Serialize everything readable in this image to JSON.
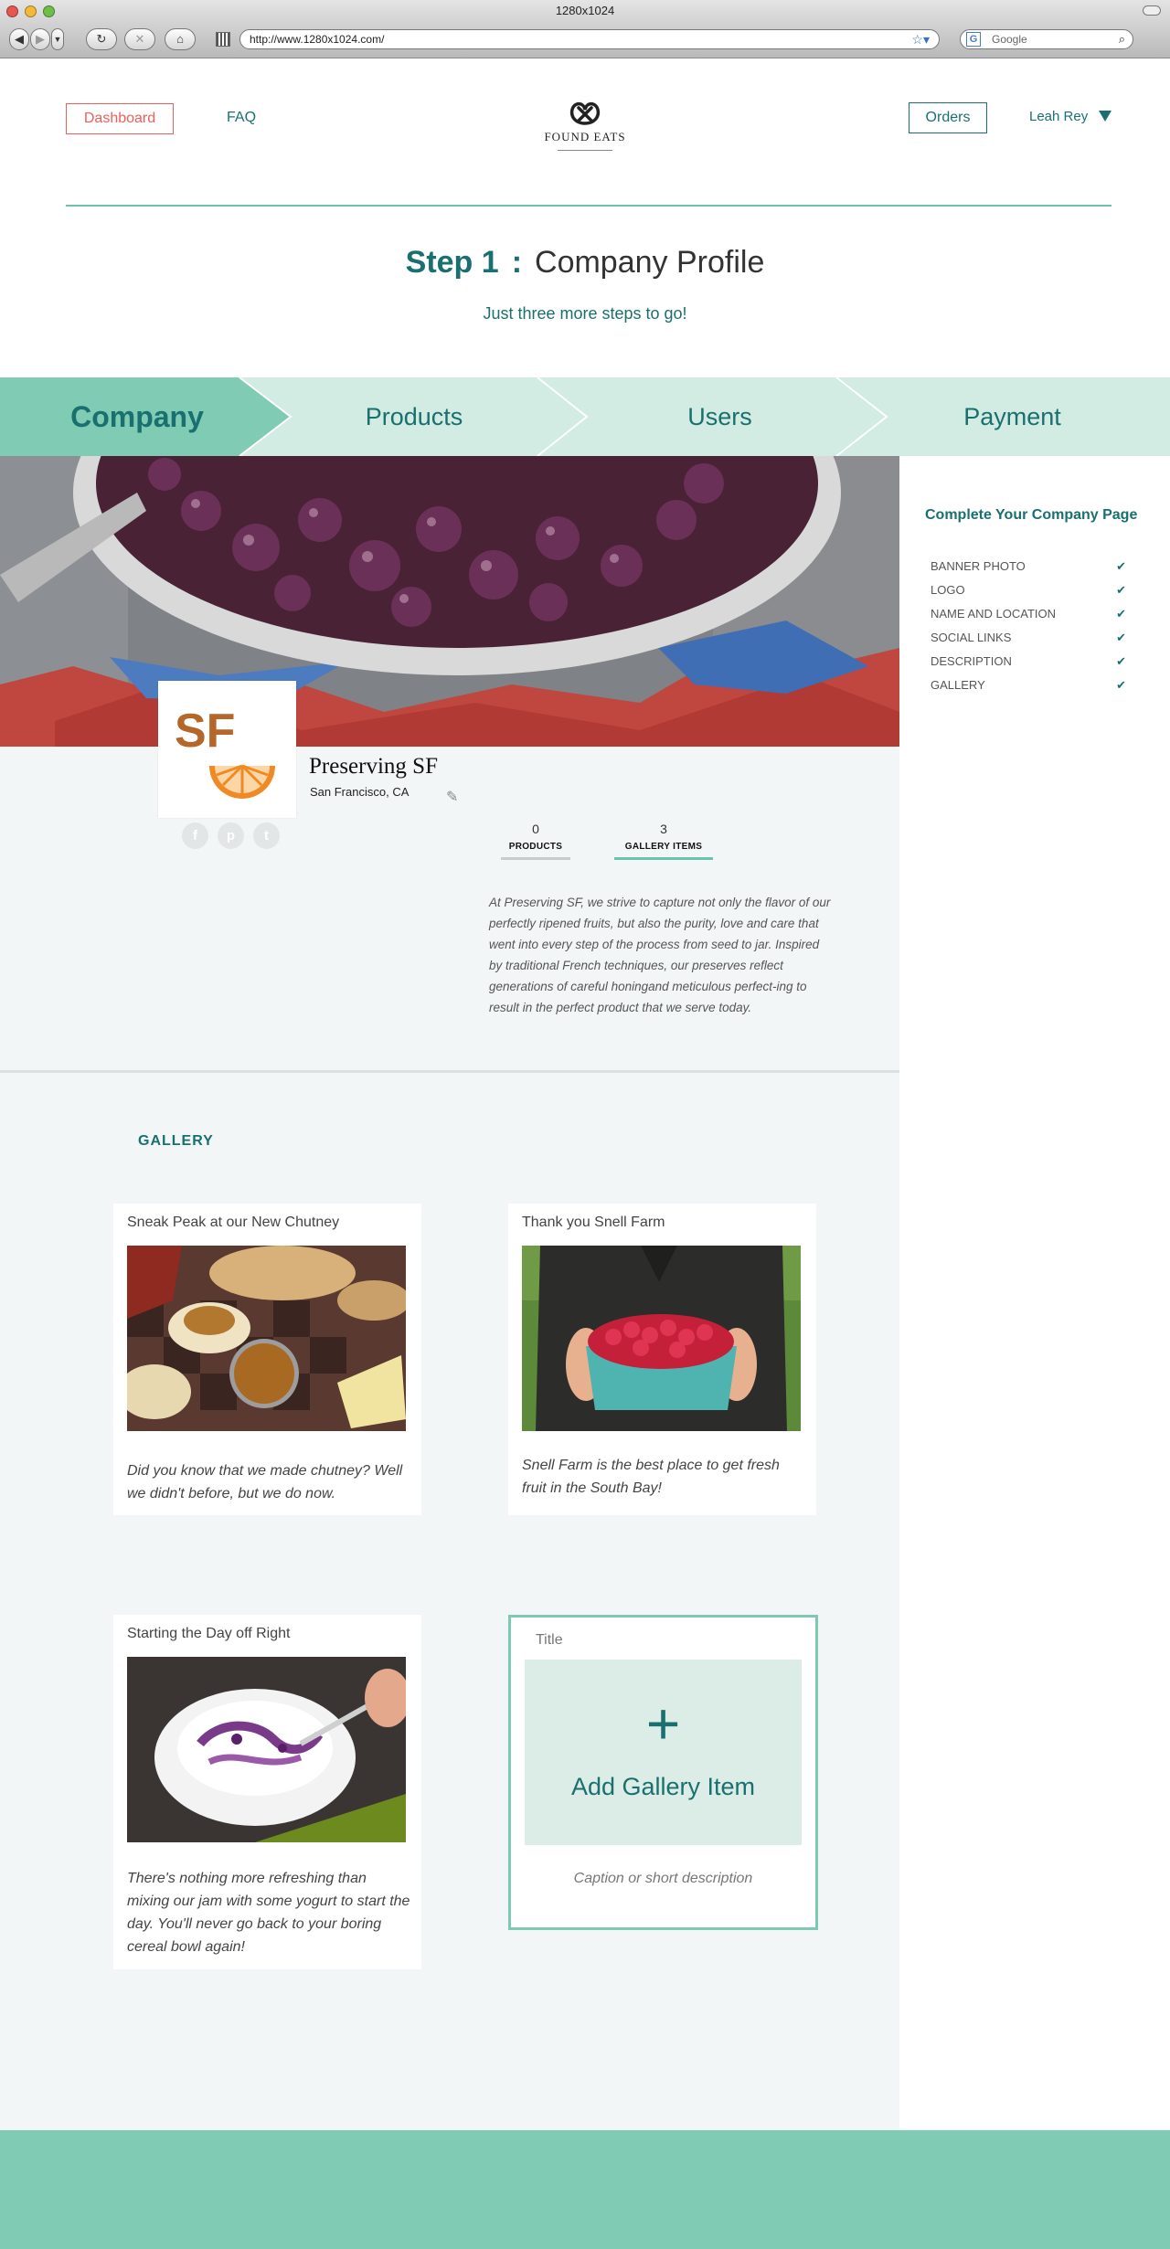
{
  "browser": {
    "window_title": "1280x1024",
    "url": "http://www.1280x1024.com/",
    "search_placeholder": "Google"
  },
  "header": {
    "dashboard_label": "Dashboard",
    "faq_label": "FAQ",
    "logo_text": "FOUND EATS",
    "orders_label": "Orders",
    "user_name": "Leah Rey"
  },
  "step": {
    "label": "Step 1",
    "separator": ":",
    "title": "Company Profile",
    "subtitle": "Just three more steps to go!"
  },
  "steps": [
    {
      "label": "Company",
      "active": true
    },
    {
      "label": "Products",
      "active": false
    },
    {
      "label": "Users",
      "active": false
    },
    {
      "label": "Payment",
      "active": false
    }
  ],
  "company": {
    "logo_initials": "SF",
    "name": "Preserving SF",
    "location": "San Francisco, CA",
    "social": [
      "facebook",
      "pinterest",
      "twitter"
    ],
    "stats": [
      {
        "value": "0",
        "label": "PRODUCTS"
      },
      {
        "value": "3",
        "label": "GALLERY ITEMS"
      }
    ],
    "description": "At Preserving SF, we strive to capture not only the flavor of our perfectly ripened fruits, but also the purity, love and care that went into every step of the process from seed to jar. Inspired by traditional French techniques, our preserves reflect generations of careful honingand meticulous perfect-ing to result in the perfect product that we serve today."
  },
  "sidebar": {
    "title": "Complete Your Company Page",
    "items": [
      {
        "label": "BANNER PHOTO"
      },
      {
        "label": "LOGO"
      },
      {
        "label": "NAME AND LOCATION"
      },
      {
        "label": "SOCIAL LINKS"
      },
      {
        "label": "DESCRIPTION"
      },
      {
        "label": "GALLERY"
      }
    ],
    "check_glyph": "✔"
  },
  "gallery": {
    "title": "GALLERY",
    "items": [
      {
        "title": "Sneak Peak at our New Chutney",
        "caption": "Did you know that we made chutney? Well we didn't before, but we do now."
      },
      {
        "title": "Thank you Snell Farm",
        "caption": "Snell Farm is the best place to get fresh fruit in the South Bay!"
      },
      {
        "title": "Starting the Day off Right",
        "caption": "There's nothing more refreshing than mixing our jam with some yogurt to start the day. You'll never go back to your boring cereal bowl again!"
      }
    ],
    "add": {
      "title_placeholder": "Title",
      "plus": "+",
      "label": "Add Gallery Item",
      "caption_placeholder": "Caption or short description"
    }
  },
  "colors": {
    "accent": "#19706f",
    "mint": "#80cbb3",
    "mint_light": "#d2ebe3",
    "alert": "#ee5f5b"
  }
}
